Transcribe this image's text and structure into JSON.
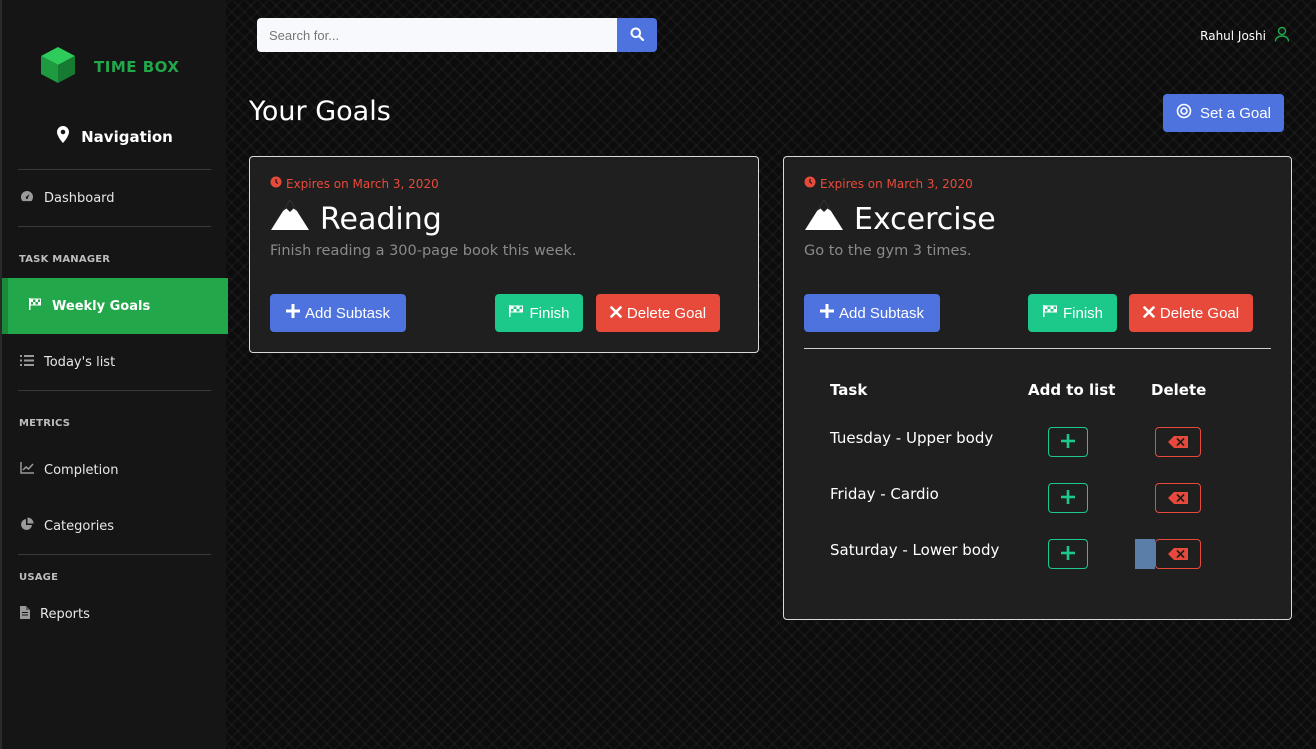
{
  "brand": {
    "name": "TIME BOX"
  },
  "sidebar": {
    "nav_title": "Navigation",
    "dashboard": "Dashboard",
    "section_task_manager": "TASK MANAGER",
    "weekly_goals": "Weekly Goals",
    "todays_list": "Today's list",
    "section_metrics": "METRICS",
    "completion": "Completion",
    "categories": "Categories",
    "section_usage": "USAGE",
    "reports": "Reports"
  },
  "search": {
    "placeholder": "Search for..."
  },
  "user": {
    "name": "Rahul Joshi"
  },
  "page": {
    "title": "Your Goals",
    "set_goal": "Set a Goal"
  },
  "goals": [
    {
      "expires": "Expires on March 3, 2020",
      "title": "Reading",
      "description": "Finish reading a 300-page book this week.",
      "add_subtask": "Add Subtask",
      "finish": "Finish",
      "delete": "Delete Goal"
    },
    {
      "expires": "Expires on March 3, 2020",
      "title": "Excercise",
      "description": "Go to the gym 3 times.",
      "add_subtask": "Add Subtask",
      "finish": "Finish",
      "delete": "Delete Goal",
      "table": {
        "headers": {
          "task": "Task",
          "add": "Add to list",
          "delete": "Delete"
        },
        "rows": [
          {
            "task": "Tuesday - Upper body"
          },
          {
            "task": "Friday - Cardio"
          },
          {
            "task": "Saturday - Lower body"
          }
        ]
      }
    }
  ],
  "colors": {
    "brand_green": "#22a84a",
    "primary": "#4e73df",
    "success": "#1cc88a",
    "danger": "#e74a3b"
  }
}
